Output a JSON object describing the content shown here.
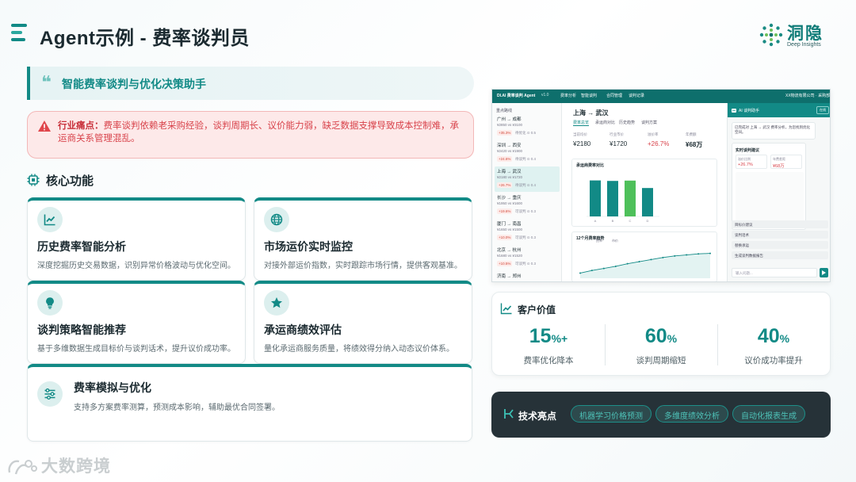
{
  "page": {
    "title": "Agent示例 - 费率谈判员"
  },
  "logo": {
    "cn": "洞隐",
    "en": "Deep Insights"
  },
  "subtitle": "智能费率谈判与优化决策助手",
  "pain": {
    "label": "行业痛点：",
    "text": "费率谈判依赖老采购经验，谈判周期长、议价能力弱，缺乏数据支撑导致成本控制难，承运商关系管理混乱。"
  },
  "core": {
    "heading": "核心功能",
    "cards": [
      {
        "title": "历史费率智能分析",
        "desc": "深度挖掘历史交易数据，识别异常价格波动与优化空间。",
        "icon": "line-chart-icon"
      },
      {
        "title": "市场运价实时监控",
        "desc": "对接外部运价指数，实时跟踪市场行情，提供客观基准。",
        "icon": "globe-icon"
      },
      {
        "title": "谈判策略智能推荐",
        "desc": "基于多维数据生成目标价与谈判话术，提升议价成功率。",
        "icon": "lightbulb-icon"
      },
      {
        "title": "承运商绩效评估",
        "desc": "量化承运商服务质量，将绩效得分纳入动态议价体系。",
        "icon": "star-icon"
      },
      {
        "title": "费率模拟与优化",
        "desc": "支持多方案费率测算，预测成本影响，辅助最优合同签署。",
        "icon": "sliders-icon"
      }
    ]
  },
  "app": {
    "title": "DI.AI 费率谈判 Agent",
    "version": "v1.0",
    "nav": [
      "费率分析",
      "智能谈判",
      "合同管理",
      "谈判记录"
    ],
    "company": "XX物流有限公司 · 采购部",
    "sidebar_caption": "重点路线",
    "routes": [
      {
        "route": "广州 → 成都",
        "price": "¥2850 vs ¥3100",
        "pct": "+35.3%",
        "status": "待优化 ⊙ 0.5"
      },
      {
        "route": "深圳 → 西安",
        "price": "¥2420 vs ¥1900",
        "pct": "+24.6%",
        "status": "待谈判 ⊙ 0.4"
      },
      {
        "route": "上海 → 武汉",
        "price": "¥2180 vs ¥1720",
        "pct": "+26.7%",
        "status": "待谈判 ⊙ 0.4"
      },
      {
        "route": "长沙 → 重庆",
        "price": "¥1950 vs ¥1600",
        "pct": "+19.6%",
        "status": "可谈判 ⊙ 0.3"
      },
      {
        "route": "厦门 → 南昌",
        "price": "¥1650 vs ¥1500",
        "pct": "+10.0%",
        "status": "可谈判 ⊙ 0.3"
      },
      {
        "route": "北京 → 杭州",
        "price": "¥1680 vs ¥1520",
        "pct": "+10.5%",
        "status": "可谈判 ⊙ 0.3"
      },
      {
        "route": "济南 → 郑州",
        "price": "",
        "pct": "",
        "status": ""
      }
    ],
    "main": {
      "route_title": "上海 → 武汉",
      "tabs": [
        "费率总览",
        "承运商对比",
        "历史趋势",
        "谈判方案"
      ],
      "kpis": [
        {
          "label": "当前均价",
          "value": "¥2180",
          "color": "#1b2a30"
        },
        {
          "label": "行业市价",
          "value": "¥1720",
          "color": "#1b2a30"
        },
        {
          "label": "溢价率",
          "value": "+26.7%",
          "color": "#d8424a"
        },
        {
          "label": "年费额",
          "value": "¥68万",
          "color": "#1b2a30"
        }
      ],
      "bar_title": "承运商费率对比",
      "trend_title": "12个月费率趋势",
      "trend_legend": [
        "费率",
        "市价"
      ]
    },
    "assistant": {
      "title": "AI 谈判助手",
      "badge": "在线",
      "message": "已完成对 上海 → 武汉 费率分析，为您找到优化空间。",
      "card_title": "实时谈判建议",
      "card_k1": "溢价比例",
      "card_v1": "+26.7%",
      "card_k2": "年费差距",
      "card_v2": "¥68万",
      "options": [
        "目标价建议",
        "谈判话术",
        "替换承运",
        "生成谈判数据报告"
      ],
      "input_placeholder": "输入问题..."
    },
    "chart_data": [
      {
        "type": "bar",
        "title": "承运商费率对比",
        "categories": [
          "A",
          "B",
          "C",
          "D"
        ],
        "values": [
          2180,
          2150,
          2170,
          1720
        ],
        "ylim": [
          0,
          2400
        ]
      },
      {
        "type": "line",
        "title": "12个月费率趋势",
        "x": [
          1,
          2,
          3,
          4,
          5,
          6,
          7,
          8,
          9,
          10,
          11,
          12
        ],
        "series": [
          {
            "name": "费率",
            "values": [
              1800,
              1850,
              1890,
              1930,
              1980,
              2020,
              2060,
              2100,
              2130,
              2150,
              2170,
              2180
            ]
          }
        ]
      }
    ]
  },
  "value": {
    "heading": "客户价值",
    "stats": [
      {
        "num": "15",
        "unit": "%+",
        "label": "费率优化降本"
      },
      {
        "num": "60",
        "unit": "%",
        "label": "谈判周期缩短"
      },
      {
        "num": "40",
        "unit": "%",
        "label": "议价成功率提升"
      }
    ]
  },
  "tech": {
    "heading": "技术亮点",
    "pills": [
      "机器学习价格预测",
      "多维度绩效分析",
      "自动化报表生成"
    ]
  },
  "watermark": "大数跨境",
  "colors": {
    "accent": "#128a86",
    "danger": "#d8424a",
    "dark": "#263238"
  }
}
